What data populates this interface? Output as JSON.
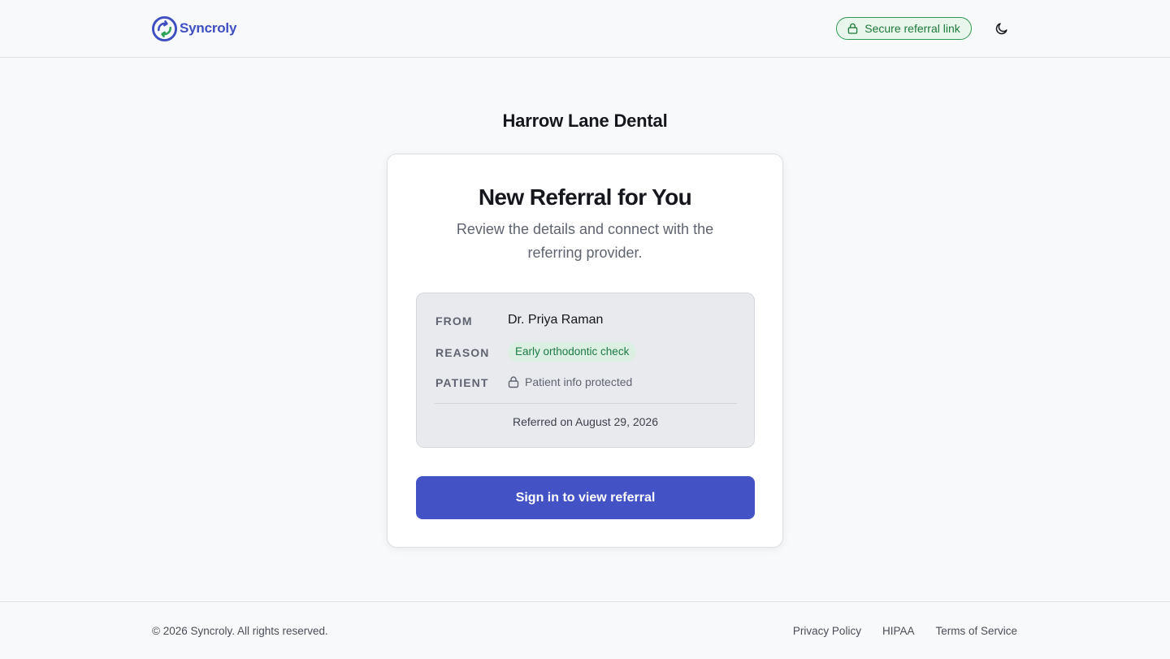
{
  "header": {
    "brand_name": "Syncroly",
    "secure_badge": "Secure referral link",
    "theme_toggle_icon": "moon-icon"
  },
  "practice": {
    "name": "Harrow Lane Dental"
  },
  "card": {
    "title": "New Referral for You",
    "subtitle": "Review the details and connect with the referring provider.",
    "details": {
      "from_label": "FROM",
      "from_value": "Dr. Priya Raman",
      "reason_label": "REASON",
      "reason_value": "Early orthodontic check",
      "patient_label": "PATIENT",
      "patient_value": "Patient info protected",
      "referred_on": "Referred on August 29, 2026"
    },
    "cta_label": "Sign in to view referral"
  },
  "footer": {
    "copyright": "© 2026 Syncroly. All rights reserved.",
    "links": [
      "Privacy Policy",
      "HIPAA",
      "Terms of Service"
    ]
  },
  "colors": {
    "brand": "#3f4fc1",
    "cta": "#4353c6",
    "secure_green": "#1e7a3a",
    "reason_badge_bg": "#dcefe3"
  }
}
